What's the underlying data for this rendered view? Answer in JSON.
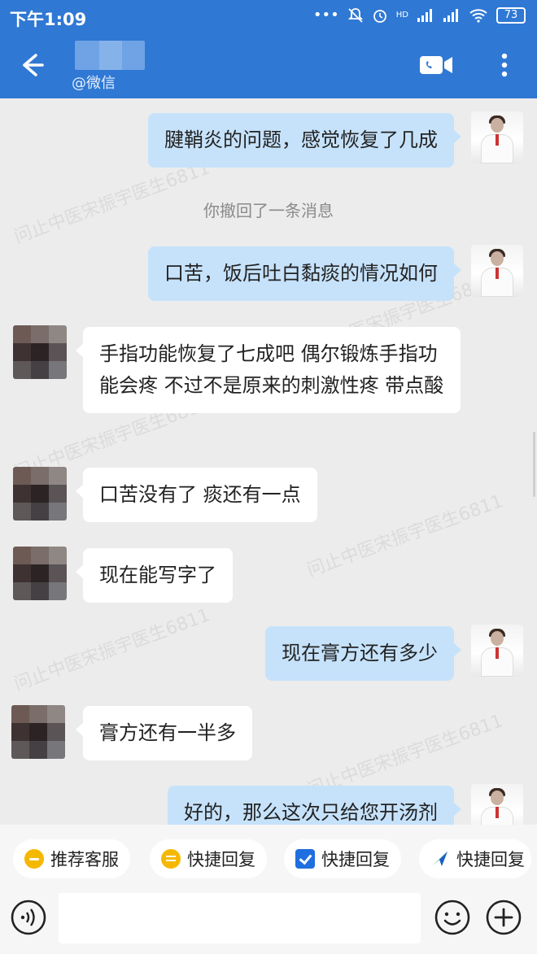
{
  "status_bar": {
    "time": "下午1:09",
    "signal_label": "HD",
    "battery": "73"
  },
  "header": {
    "contact_source": "@微信"
  },
  "messages": [
    {
      "side": "out",
      "text": "腱鞘炎的问题，感觉恢复了几成"
    },
    {
      "side": "system",
      "text": "你撤回了一条消息"
    },
    {
      "side": "out",
      "text": "口苦，饭后吐白黏痰的情况如何"
    },
    {
      "side": "in",
      "text": "手指功能恢复了七成吧 偶尔锻炼手指功能会疼 不过不是原来的刺激性疼 带点酸"
    },
    {
      "side": "in",
      "text": "口苦没有了 痰还有一点"
    },
    {
      "side": "in",
      "text": "现在能写字了"
    },
    {
      "side": "out",
      "text": "现在膏方还有多少"
    },
    {
      "side": "in",
      "text": "膏方还有一半多"
    },
    {
      "side": "out",
      "text": "好的，那么这次只给您开汤剂"
    }
  ],
  "watermark_text": "问止中医宋振宇医生6811",
  "quick_replies": [
    {
      "label": "推荐客服",
      "icon": "chat-bubble-icon"
    },
    {
      "label": "快捷回复",
      "icon": "note-icon"
    },
    {
      "label": "快捷回复",
      "icon": "checkbox-icon"
    },
    {
      "label": "快捷回复",
      "icon": "send-arrow-icon"
    }
  ],
  "input": {
    "value": "",
    "placeholder": ""
  },
  "colors": {
    "header_blue": "#2f78d4",
    "bubble_out": "#c6e2fb",
    "bubble_in": "#ffffff",
    "chat_bg": "#ececec"
  }
}
